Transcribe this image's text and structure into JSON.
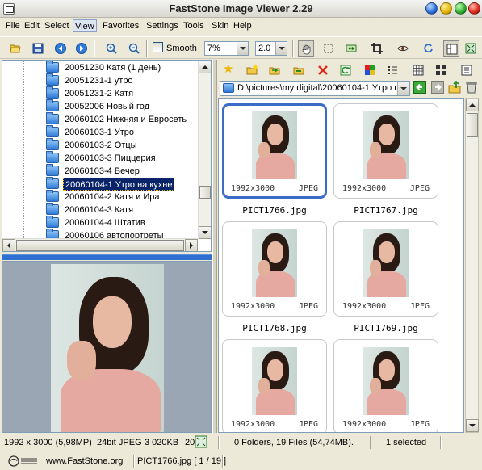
{
  "window": {
    "title": "FastStone Image Viewer 2.29"
  },
  "menu": [
    "File",
    "Edit",
    "Select",
    "View",
    "Favorites",
    "Settings",
    "Tools",
    "Skin",
    "Help"
  ],
  "toolbar": {
    "smooth_label": "Smooth",
    "zoom_value": "7%",
    "ratio_value": "2.0"
  },
  "tree": {
    "items": [
      "20051230 Катя (1 день)",
      "20051231-1 утро",
      "20051231-2 Катя",
      "20052006 Новый год",
      "20060102 Нижняя и Евросеть",
      "20060103-1 Утро",
      "20060103-2 Отцы",
      "20060103-3 Пиццерия",
      "20060103-4 Вечер",
      "20060104-1 Утро на кухне",
      "20060104-2 Катя и Ира",
      "20060104-3 Катя",
      "20060104-4 Штатив",
      "20060106 автопортреты"
    ],
    "selected_index": 9
  },
  "path": {
    "value": "D:\\pictures\\my digital\\20060104-1 Утро н"
  },
  "thumbnails": [
    {
      "file": "PICT1766.jpg",
      "dims": "1992x3000",
      "type": "JPEG",
      "selected": true
    },
    {
      "file": "PICT1767.jpg",
      "dims": "1992x3000",
      "type": "JPEG",
      "selected": false
    },
    {
      "file": "PICT1768.jpg",
      "dims": "1992x3000",
      "type": "JPEG",
      "selected": false
    },
    {
      "file": "PICT1769.jpg",
      "dims": "1992x3000",
      "type": "JPEG",
      "selected": false
    },
    {
      "file": "",
      "dims": "1992x3000",
      "type": "JPEG",
      "selected": false
    },
    {
      "file": "",
      "dims": "1992x3000",
      "type": "JPEG",
      "selected": false
    }
  ],
  "status": {
    "image_size": "1992 x 3000 (5,98MP)",
    "format": "24bit JPEG",
    "file_size": "3 020KB",
    "extra": "20",
    "folder_info": "0 Folders, 19 Files (54,74MB).",
    "selection": "1 selected",
    "website": "www.FastStone.org",
    "current_file": "PICT1766.jpg [ 1 / 19 ]"
  },
  "colors": {
    "selection_blue": "#0a246a",
    "thumb_selected_border": "#3a6cc8",
    "splitter_blue": "#2f6fd0"
  }
}
